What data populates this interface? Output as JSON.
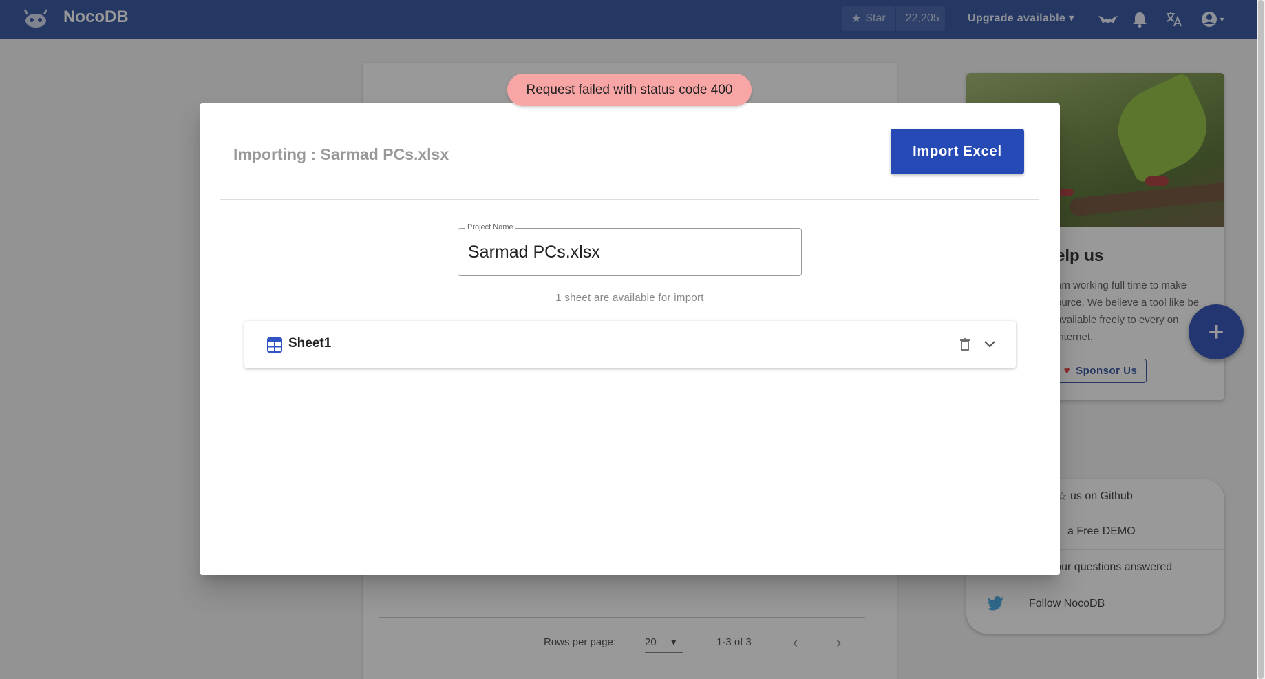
{
  "topbar": {
    "brand": "NocoDB",
    "star_label": "Star",
    "star_count": "22,205",
    "upgrade_label": "Upgrade available",
    "icons": [
      "nocodb-logo-icon",
      "bat-icon",
      "bell-icon",
      "translate-icon",
      "account-icon"
    ]
  },
  "background": {
    "rows_per_page_label": "Rows per page:",
    "rows_per_page_value": "20",
    "range_label": "1-3 of 3",
    "side_title": "elp us",
    "side_text": "am working full time to make ource. We believe a tool like be available freely to every on internet.",
    "sponsor_label": "Sponsor Us",
    "links": [
      {
        "label": "us on Github",
        "icon": "star-icon"
      },
      {
        "label": "a Free DEMO",
        "icon": "demo-icon"
      },
      {
        "label": "Get your questions answered",
        "icon": "chat-icon"
      },
      {
        "label": "Follow NocoDB",
        "icon": "twitter-icon"
      }
    ]
  },
  "toast": {
    "message": "Request failed with status code 400"
  },
  "dialog": {
    "title": "Importing : Sarmad PCs.xlsx",
    "import_button": "Import Excel",
    "project_name_label": "Project Name",
    "project_name_value": "Sarmad PCs.xlsx",
    "available_text": "1 sheet are available for import",
    "sheets": [
      {
        "name": "Sheet1"
      }
    ]
  },
  "colors": {
    "primary": "#2549b5",
    "topbar": "#2a4d9b",
    "toast_error": "#f8a5a5"
  }
}
